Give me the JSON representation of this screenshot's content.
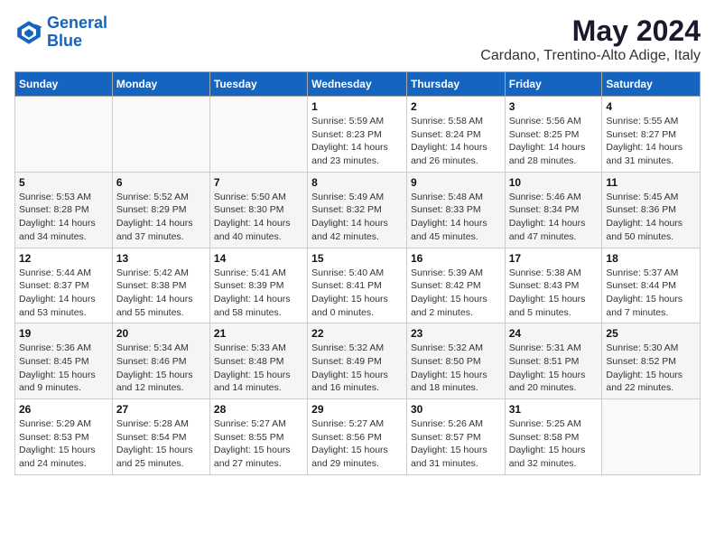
{
  "header": {
    "logo_line1": "General",
    "logo_line2": "Blue",
    "title": "May 2024",
    "subtitle": "Cardano, Trentino-Alto Adige, Italy"
  },
  "days_of_week": [
    "Sunday",
    "Monday",
    "Tuesday",
    "Wednesday",
    "Thursday",
    "Friday",
    "Saturday"
  ],
  "weeks": [
    [
      {
        "num": "",
        "info": ""
      },
      {
        "num": "",
        "info": ""
      },
      {
        "num": "",
        "info": ""
      },
      {
        "num": "1",
        "info": "Sunrise: 5:59 AM\nSunset: 8:23 PM\nDaylight: 14 hours and 23 minutes."
      },
      {
        "num": "2",
        "info": "Sunrise: 5:58 AM\nSunset: 8:24 PM\nDaylight: 14 hours and 26 minutes."
      },
      {
        "num": "3",
        "info": "Sunrise: 5:56 AM\nSunset: 8:25 PM\nDaylight: 14 hours and 28 minutes."
      },
      {
        "num": "4",
        "info": "Sunrise: 5:55 AM\nSunset: 8:27 PM\nDaylight: 14 hours and 31 minutes."
      }
    ],
    [
      {
        "num": "5",
        "info": "Sunrise: 5:53 AM\nSunset: 8:28 PM\nDaylight: 14 hours and 34 minutes."
      },
      {
        "num": "6",
        "info": "Sunrise: 5:52 AM\nSunset: 8:29 PM\nDaylight: 14 hours and 37 minutes."
      },
      {
        "num": "7",
        "info": "Sunrise: 5:50 AM\nSunset: 8:30 PM\nDaylight: 14 hours and 40 minutes."
      },
      {
        "num": "8",
        "info": "Sunrise: 5:49 AM\nSunset: 8:32 PM\nDaylight: 14 hours and 42 minutes."
      },
      {
        "num": "9",
        "info": "Sunrise: 5:48 AM\nSunset: 8:33 PM\nDaylight: 14 hours and 45 minutes."
      },
      {
        "num": "10",
        "info": "Sunrise: 5:46 AM\nSunset: 8:34 PM\nDaylight: 14 hours and 47 minutes."
      },
      {
        "num": "11",
        "info": "Sunrise: 5:45 AM\nSunset: 8:36 PM\nDaylight: 14 hours and 50 minutes."
      }
    ],
    [
      {
        "num": "12",
        "info": "Sunrise: 5:44 AM\nSunset: 8:37 PM\nDaylight: 14 hours and 53 minutes."
      },
      {
        "num": "13",
        "info": "Sunrise: 5:42 AM\nSunset: 8:38 PM\nDaylight: 14 hours and 55 minutes."
      },
      {
        "num": "14",
        "info": "Sunrise: 5:41 AM\nSunset: 8:39 PM\nDaylight: 14 hours and 58 minutes."
      },
      {
        "num": "15",
        "info": "Sunrise: 5:40 AM\nSunset: 8:41 PM\nDaylight: 15 hours and 0 minutes."
      },
      {
        "num": "16",
        "info": "Sunrise: 5:39 AM\nSunset: 8:42 PM\nDaylight: 15 hours and 2 minutes."
      },
      {
        "num": "17",
        "info": "Sunrise: 5:38 AM\nSunset: 8:43 PM\nDaylight: 15 hours and 5 minutes."
      },
      {
        "num": "18",
        "info": "Sunrise: 5:37 AM\nSunset: 8:44 PM\nDaylight: 15 hours and 7 minutes."
      }
    ],
    [
      {
        "num": "19",
        "info": "Sunrise: 5:36 AM\nSunset: 8:45 PM\nDaylight: 15 hours and 9 minutes."
      },
      {
        "num": "20",
        "info": "Sunrise: 5:34 AM\nSunset: 8:46 PM\nDaylight: 15 hours and 12 minutes."
      },
      {
        "num": "21",
        "info": "Sunrise: 5:33 AM\nSunset: 8:48 PM\nDaylight: 15 hours and 14 minutes."
      },
      {
        "num": "22",
        "info": "Sunrise: 5:32 AM\nSunset: 8:49 PM\nDaylight: 15 hours and 16 minutes."
      },
      {
        "num": "23",
        "info": "Sunrise: 5:32 AM\nSunset: 8:50 PM\nDaylight: 15 hours and 18 minutes."
      },
      {
        "num": "24",
        "info": "Sunrise: 5:31 AM\nSunset: 8:51 PM\nDaylight: 15 hours and 20 minutes."
      },
      {
        "num": "25",
        "info": "Sunrise: 5:30 AM\nSunset: 8:52 PM\nDaylight: 15 hours and 22 minutes."
      }
    ],
    [
      {
        "num": "26",
        "info": "Sunrise: 5:29 AM\nSunset: 8:53 PM\nDaylight: 15 hours and 24 minutes."
      },
      {
        "num": "27",
        "info": "Sunrise: 5:28 AM\nSunset: 8:54 PM\nDaylight: 15 hours and 25 minutes."
      },
      {
        "num": "28",
        "info": "Sunrise: 5:27 AM\nSunset: 8:55 PM\nDaylight: 15 hours and 27 minutes."
      },
      {
        "num": "29",
        "info": "Sunrise: 5:27 AM\nSunset: 8:56 PM\nDaylight: 15 hours and 29 minutes."
      },
      {
        "num": "30",
        "info": "Sunrise: 5:26 AM\nSunset: 8:57 PM\nDaylight: 15 hours and 31 minutes."
      },
      {
        "num": "31",
        "info": "Sunrise: 5:25 AM\nSunset: 8:58 PM\nDaylight: 15 hours and 32 minutes."
      },
      {
        "num": "",
        "info": ""
      }
    ]
  ]
}
